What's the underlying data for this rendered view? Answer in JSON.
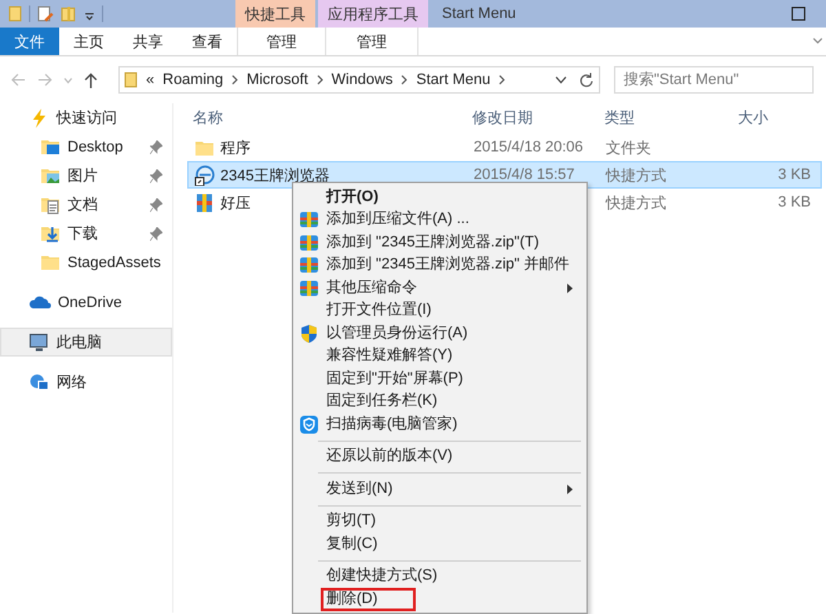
{
  "window": {
    "title": "Start Menu"
  },
  "context_tabs": [
    {
      "label": "快捷工具",
      "color": "#f8c9b0"
    },
    {
      "label": "应用程序工具",
      "color": "#e6c8f0"
    }
  ],
  "ribbon_tabs": [
    {
      "label": "文件",
      "kind": "file",
      "selected": false
    },
    {
      "label": "主页",
      "kind": "tab",
      "selected": false
    },
    {
      "label": "共享",
      "kind": "tab",
      "selected": false
    },
    {
      "label": "查看",
      "kind": "tab",
      "selected": false
    },
    {
      "label": "管理",
      "kind": "context",
      "selected": false
    },
    {
      "label": "管理",
      "kind": "context",
      "selected": false
    }
  ],
  "address_bar": {
    "overflow": "«",
    "breadcrumbs": [
      "Roaming",
      "Microsoft",
      "Windows",
      "Start Menu"
    ]
  },
  "search": {
    "placeholder": "搜索\"Start Menu\""
  },
  "nav_pane": {
    "items": [
      {
        "label": "快速访问",
        "kind": "star",
        "selected": false,
        "children": [
          {
            "label": "Desktop",
            "kind": "desktop",
            "pinned": true,
            "selected": false
          },
          {
            "label": "图片",
            "kind": "pictures",
            "pinned": true,
            "selected": false
          },
          {
            "label": "文档",
            "kind": "documents",
            "pinned": true,
            "selected": false
          },
          {
            "label": "下载",
            "kind": "downloads",
            "pinned": true,
            "selected": false
          },
          {
            "label": "StagedAssets",
            "kind": "folder",
            "pinned": false,
            "selected": false
          }
        ]
      },
      {
        "label": "OneDrive",
        "kind": "cloud",
        "selected": false
      },
      {
        "label": "此电脑",
        "kind": "computer",
        "selected": true
      },
      {
        "label": "网络",
        "kind": "network",
        "selected": false
      }
    ]
  },
  "file_list": {
    "columns": [
      "名称",
      "修改日期",
      "类型",
      "大小"
    ],
    "rows": [
      {
        "name": "程序",
        "kind": "folder",
        "modified": "2015/4/18 20:06",
        "type": "文件夹",
        "selected": false
      },
      {
        "name": "2345王牌浏览器",
        "kind": "shortcut",
        "modified": "2015/4/8 15:57",
        "type": "快捷方式",
        "size": "3 KB",
        "selected": true
      },
      {
        "name": "好压",
        "kind": "archiver",
        "type": "快捷方式",
        "size": "3 KB",
        "selected": false
      }
    ]
  },
  "context_menu": {
    "items": [
      {
        "kind": "plain",
        "label": "打开(O)",
        "default": true
      },
      {
        "kind": "archive",
        "label": "添加到压缩文件(A) ..."
      },
      {
        "kind": "archive",
        "label": "添加到 \"2345王牌浏览器.zip\"(T)"
      },
      {
        "kind": "archive",
        "label": "添加到 \"2345王牌浏览器.zip\" 并邮件"
      },
      {
        "kind": "archive",
        "label": "其他压缩命令",
        "submenu": true
      },
      {
        "kind": "plain",
        "label": "打开文件位置(I)"
      },
      {
        "kind": "shield",
        "label": "以管理员身份运行(A)"
      },
      {
        "kind": "plain",
        "label": "兼容性疑难解答(Y)"
      },
      {
        "kind": "plain",
        "label": "固定到\"开始\"屏幕(P)"
      },
      {
        "kind": "plain",
        "label": "固定到任务栏(K)"
      },
      {
        "kind": "guard",
        "label": "扫描病毒(电脑管家)"
      },
      {
        "kind": "separator"
      },
      {
        "kind": "plain",
        "label": "还原以前的版本(V)"
      },
      {
        "kind": "separator"
      },
      {
        "kind": "plain",
        "label": "发送到(N)",
        "submenu": true
      },
      {
        "kind": "separator"
      },
      {
        "kind": "plain",
        "label": "剪切(T)"
      },
      {
        "kind": "plain",
        "label": "复制(C)"
      },
      {
        "kind": "separator"
      },
      {
        "kind": "plain",
        "label": "创建快捷方式(S)"
      },
      {
        "kind": "plain",
        "label": "删除(D)",
        "marked": true
      }
    ]
  }
}
